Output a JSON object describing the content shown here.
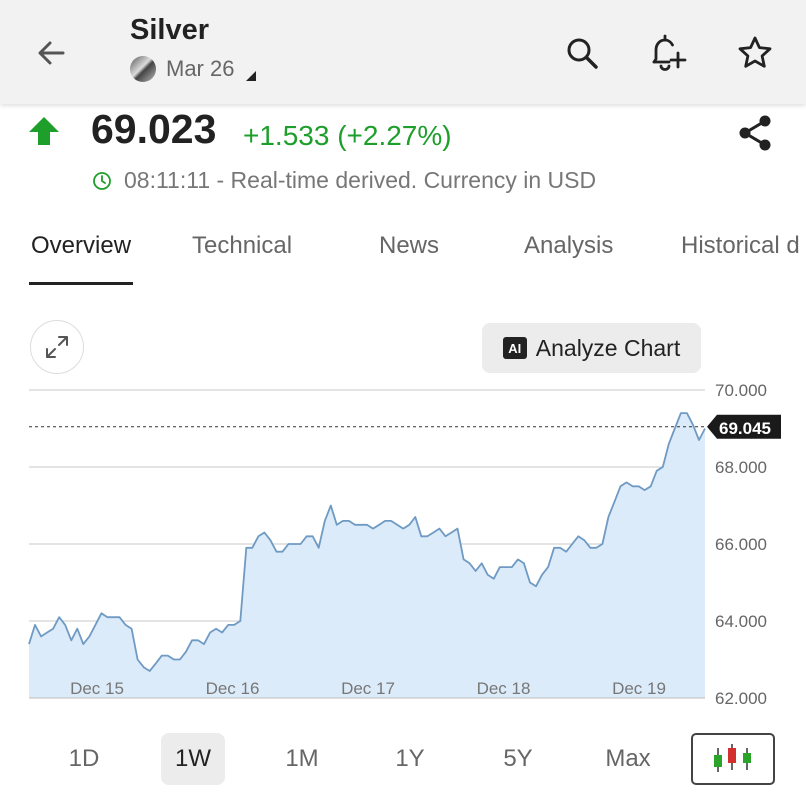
{
  "header": {
    "title": "Silver",
    "contract": "Mar 26"
  },
  "quote": {
    "price": "69.023",
    "change": "+1.533 (+2.27%)",
    "realtime_text": "08:11:11 - Real-time derived. Currency in USD",
    "direction": "up",
    "up_color": "#1e9e2b"
  },
  "tabs": [
    {
      "label": "Overview",
      "active": true
    },
    {
      "label": "Technical"
    },
    {
      "label": "News"
    },
    {
      "label": "Analysis"
    },
    {
      "label": "Historical d"
    }
  ],
  "chart_controls": {
    "analyze_label": "Analyze Chart",
    "ai_badge": "AI"
  },
  "chart_data": {
    "type": "area",
    "x_labels": [
      "Dec 15",
      "Dec 16",
      "Dec 17",
      "Dec 18",
      "Dec 19"
    ],
    "y_ticks": [
      "70.000",
      "68.000",
      "66.000",
      "64.000",
      "62.000"
    ],
    "ylim": [
      62,
      70
    ],
    "current_label": "69.045",
    "current_value": 69.045,
    "grid": true,
    "line_color": "#6f9ac4",
    "fill_color": "#dcebf9",
    "values": [
      63.4,
      63.9,
      63.6,
      63.7,
      63.8,
      64.1,
      63.9,
      63.5,
      63.8,
      63.4,
      63.6,
      63.9,
      64.2,
      64.1,
      64.1,
      64.1,
      63.9,
      63.8,
      63.0,
      62.8,
      62.7,
      62.9,
      63.1,
      63.1,
      63.0,
      63.0,
      63.2,
      63.5,
      63.5,
      63.4,
      63.7,
      63.8,
      63.7,
      63.9,
      63.9,
      64.0,
      65.9,
      65.9,
      66.2,
      66.3,
      66.1,
      65.8,
      65.8,
      66.0,
      66.0,
      66.0,
      66.2,
      66.2,
      65.9,
      66.6,
      67.0,
      66.5,
      66.6,
      66.6,
      66.5,
      66.5,
      66.5,
      66.4,
      66.5,
      66.6,
      66.6,
      66.5,
      66.4,
      66.5,
      66.7,
      66.2,
      66.2,
      66.3,
      66.4,
      66.2,
      66.3,
      66.4,
      65.6,
      65.5,
      65.3,
      65.5,
      65.2,
      65.1,
      65.4,
      65.4,
      65.4,
      65.6,
      65.5,
      65.0,
      64.9,
      65.2,
      65.4,
      65.9,
      65.9,
      65.8,
      66.0,
      66.2,
      66.1,
      65.9,
      65.9,
      66.0,
      66.7,
      67.1,
      67.5,
      67.6,
      67.5,
      67.5,
      67.4,
      67.5,
      67.9,
      68.0,
      68.6,
      69.0,
      69.4,
      69.4,
      69.1,
      68.7,
      69.0
    ]
  },
  "ranges": [
    {
      "label": "1D"
    },
    {
      "label": "1W",
      "active": true
    },
    {
      "label": "1M"
    },
    {
      "label": "1Y"
    },
    {
      "label": "5Y"
    },
    {
      "label": "Max"
    }
  ]
}
